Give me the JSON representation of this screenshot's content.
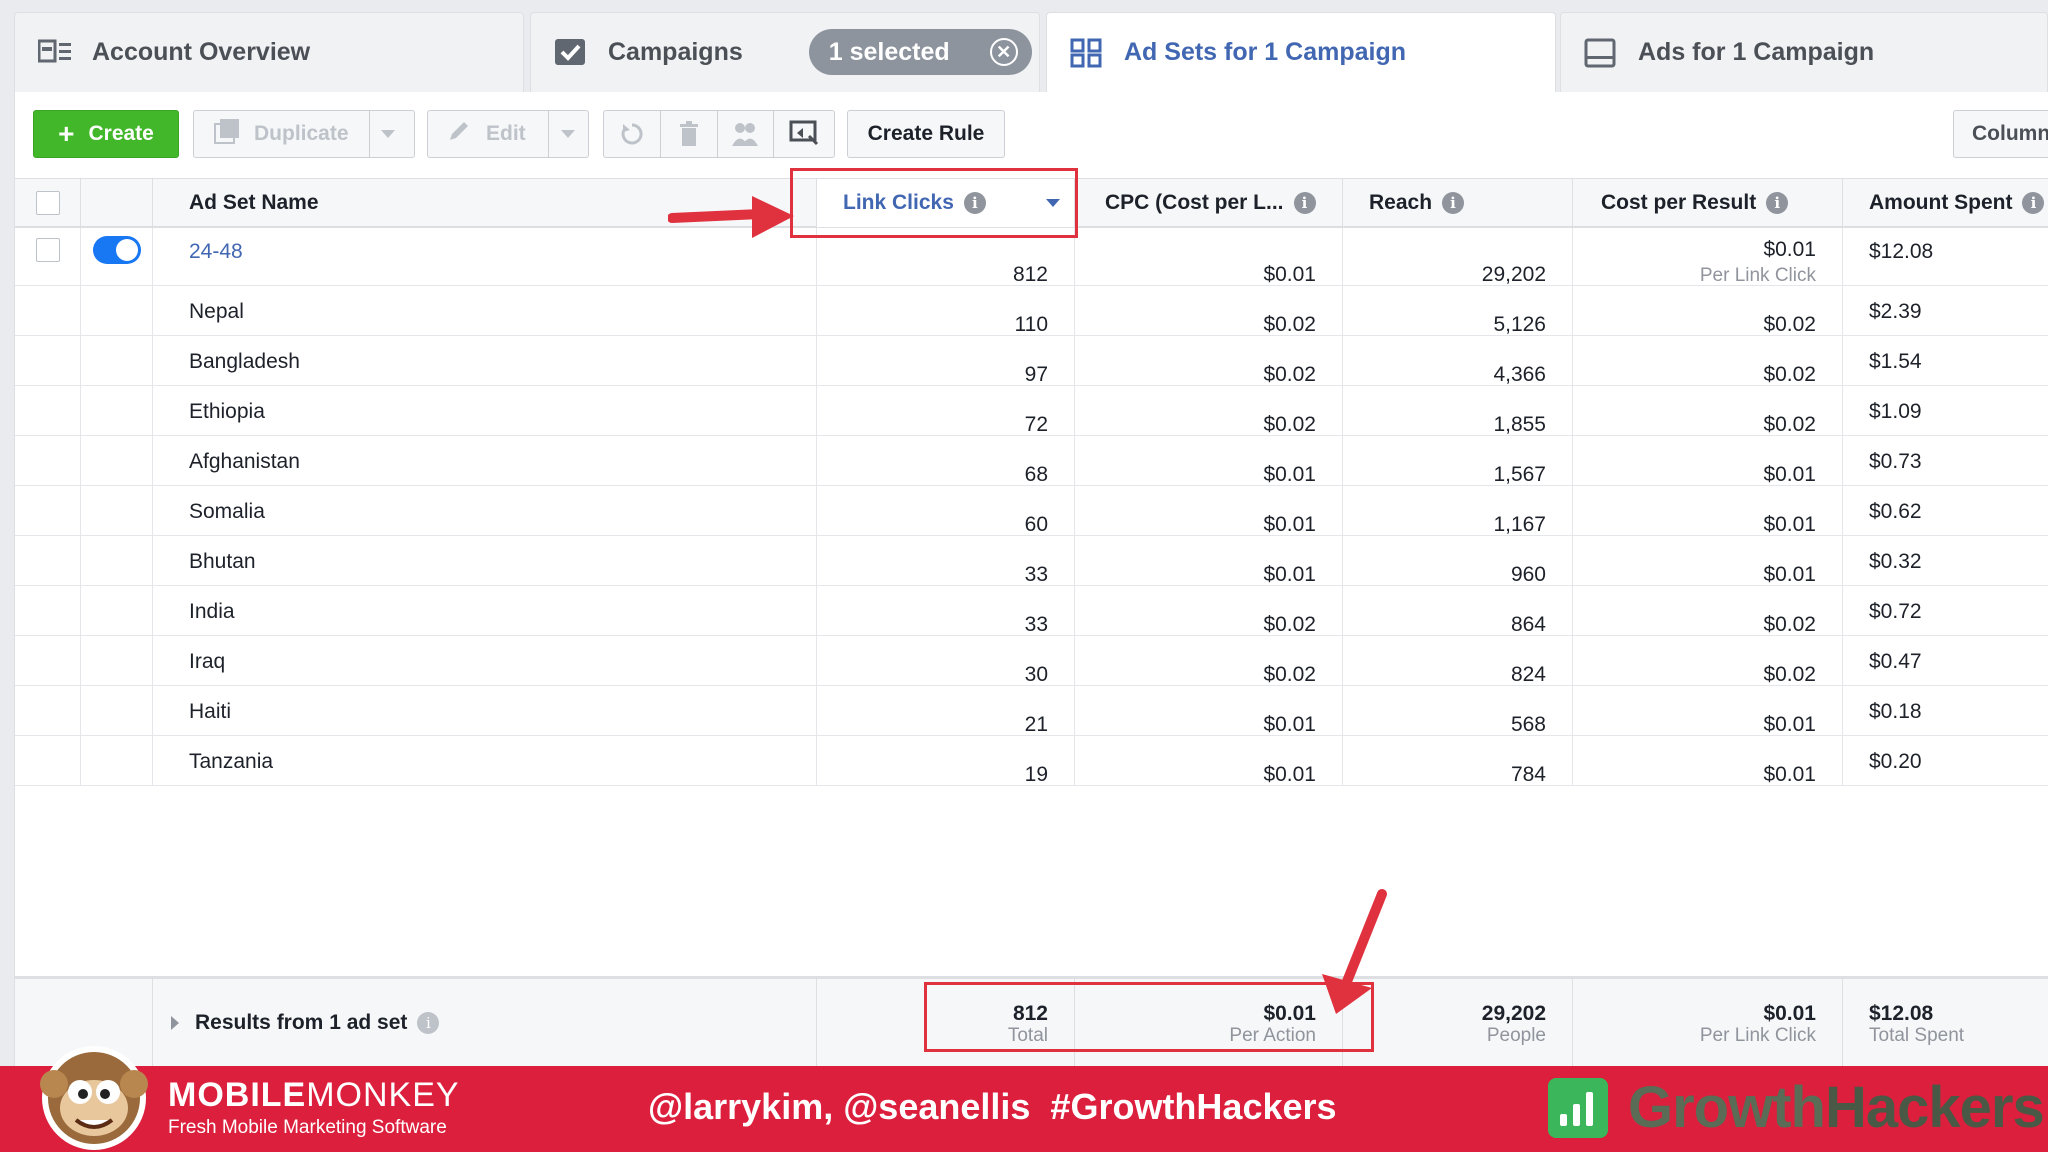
{
  "tabs": {
    "account_overview": "Account Overview",
    "campaigns": "Campaigns",
    "selected_pill": "1 selected",
    "ad_sets": "Ad Sets for 1 Campaign",
    "ads": "Ads for 1 Campaign"
  },
  "toolbar": {
    "create": "Create",
    "duplicate": "Duplicate",
    "edit": "Edit",
    "create_rule": "Create Rule",
    "columns": "Column"
  },
  "table": {
    "headers": {
      "name": "Ad Set Name",
      "link_clicks": "Link Clicks",
      "cpc": "CPC (Cost per L...",
      "reach": "Reach",
      "cost_per_result": "Cost per Result",
      "amount_spent": "Amount Spent"
    },
    "rows": [
      {
        "name": "24-48",
        "link_clicks": "812",
        "cpc": "$0.01",
        "reach": "29,202",
        "cost_per_result": "$0.01",
        "cpr_sub": "Per Link Click",
        "amount_spent": "$12.08"
      },
      {
        "name": "Nepal",
        "link_clicks": "110",
        "cpc": "$0.02",
        "reach": "5,126",
        "cost_per_result": "$0.02",
        "amount_spent": "$2.39"
      },
      {
        "name": "Bangladesh",
        "link_clicks": "97",
        "cpc": "$0.02",
        "reach": "4,366",
        "cost_per_result": "$0.02",
        "amount_spent": "$1.54"
      },
      {
        "name": "Ethiopia",
        "link_clicks": "72",
        "cpc": "$0.02",
        "reach": "1,855",
        "cost_per_result": "$0.02",
        "amount_spent": "$1.09"
      },
      {
        "name": "Afghanistan",
        "link_clicks": "68",
        "cpc": "$0.01",
        "reach": "1,567",
        "cost_per_result": "$0.01",
        "amount_spent": "$0.73"
      },
      {
        "name": "Somalia",
        "link_clicks": "60",
        "cpc": "$0.01",
        "reach": "1,167",
        "cost_per_result": "$0.01",
        "amount_spent": "$0.62"
      },
      {
        "name": "Bhutan",
        "link_clicks": "33",
        "cpc": "$0.01",
        "reach": "960",
        "cost_per_result": "$0.01",
        "amount_spent": "$0.32"
      },
      {
        "name": "India",
        "link_clicks": "33",
        "cpc": "$0.02",
        "reach": "864",
        "cost_per_result": "$0.02",
        "amount_spent": "$0.72"
      },
      {
        "name": "Iraq",
        "link_clicks": "30",
        "cpc": "$0.02",
        "reach": "824",
        "cost_per_result": "$0.02",
        "amount_spent": "$0.47"
      },
      {
        "name": "Haiti",
        "link_clicks": "21",
        "cpc": "$0.01",
        "reach": "568",
        "cost_per_result": "$0.01",
        "amount_spent": "$0.18"
      },
      {
        "name": "Tanzania",
        "link_clicks": "19",
        "cpc": "$0.01",
        "reach": "784",
        "cost_per_result": "$0.01",
        "amount_spent": "$0.20"
      }
    ],
    "footer": {
      "label": "Results from 1 ad set",
      "link_clicks": "812",
      "link_clicks_sub": "Total",
      "cpc": "$0.01",
      "cpc_sub": "Per Action",
      "reach": "29,202",
      "reach_sub": "People",
      "cost_per_result": "$0.01",
      "cpr_sub": "Per Link Click",
      "amount_spent": "$12.08",
      "amount_sub": "Total Spent"
    }
  },
  "banner": {
    "brand_bold": "MOBILE",
    "brand_light": "MONKEY",
    "tagline": "Fresh Mobile Marketing Software",
    "handles": "@larrykim, @seanellis  #GrowthHackers",
    "gh_growth": "Growth",
    "gh_hackers": "Hackers"
  },
  "colors": {
    "accent": "#4267b2",
    "create_green": "#42b72a",
    "annotation_red": "#e0323e",
    "banner_red": "#dc1f3c"
  }
}
